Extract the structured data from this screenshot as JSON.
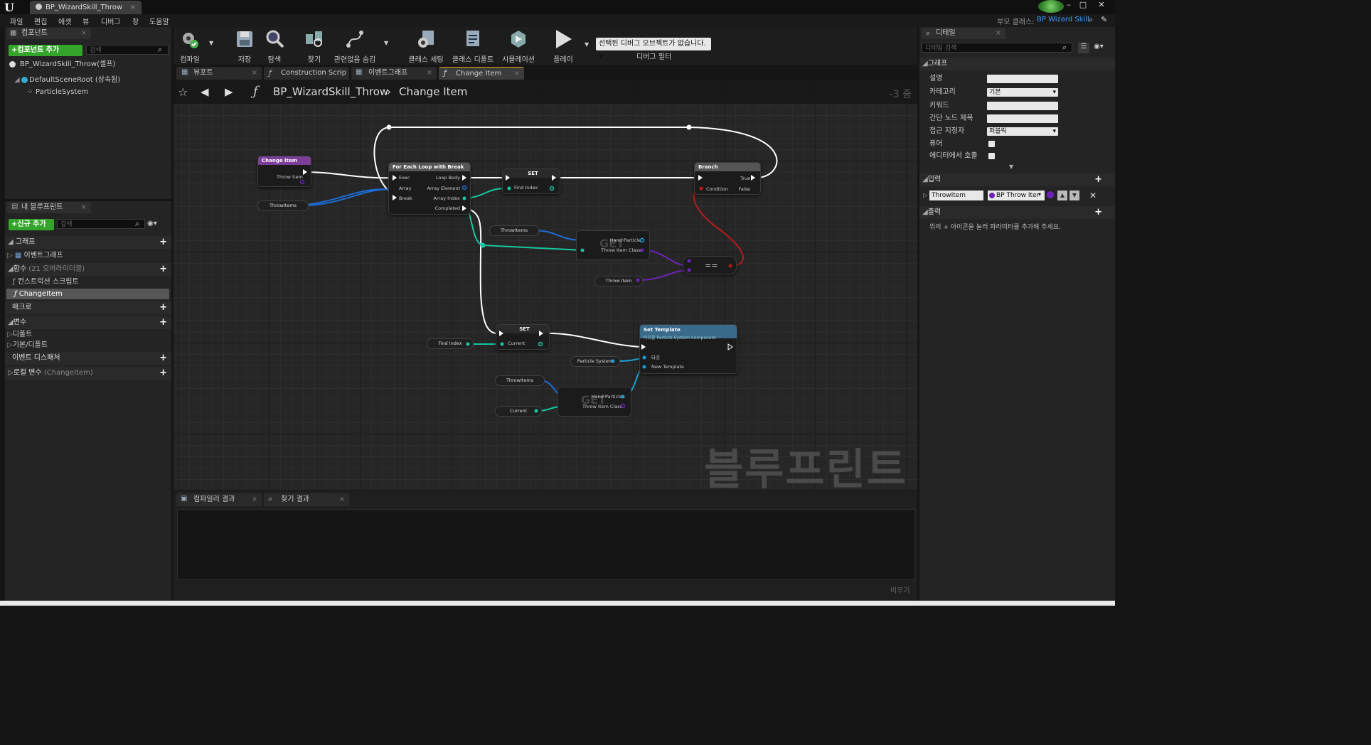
{
  "window": {
    "tab_title": "BP_WizardSkill_Throw"
  },
  "menu": [
    "파일",
    "편집",
    "에셋",
    "뷰",
    "디버그",
    "창",
    "도움말"
  ],
  "parent_class": {
    "label": "부모 클래스:",
    "value": "BP Wizard Skill"
  },
  "components_panel": {
    "tab": "컴포넌트",
    "add_button": "+컴포넌트 추가",
    "search_placeholder": "검색",
    "root": "BP_WizardSkill_Throw(셀프)",
    "items": [
      "DefaultSceneRoot (상속됨)",
      "ParticleSystem"
    ]
  },
  "my_blueprint_panel": {
    "tab": "내 블루프린트",
    "add_button": "+신규 추가",
    "search_placeholder": "검색",
    "graph": "그래프",
    "event_graph": "이벤트그래프",
    "functions": "함수",
    "functions_overridable": "(21 오버라이더블)",
    "construction_script": "컨스트럭션 스크립트",
    "change_item": "ChangeItem",
    "macros": "매크로",
    "variables": "변수",
    "default": "디폴트",
    "basic_default": "기본/디폴트",
    "event_dispatchers": "이벤트 디스패처",
    "local_vars": "로컬 변수",
    "local_vars_scope": "(ChangeItem)"
  },
  "toolbar": [
    {
      "label": "컴파일",
      "icon": "compile-icon"
    },
    {
      "label": "저장",
      "icon": "save-icon"
    },
    {
      "label": "탐색",
      "icon": "browse-icon"
    },
    {
      "label": "찾기",
      "icon": "find-icon"
    },
    {
      "label": "관련없음 숨김",
      "icon": "hide-unrelated-icon"
    },
    {
      "label": "클래스 세팅",
      "icon": "class-settings-icon"
    },
    {
      "label": "클래스 디폴트",
      "icon": "class-defaults-icon"
    },
    {
      "label": "시뮬레이션",
      "icon": "simulation-icon"
    },
    {
      "label": "플레이",
      "icon": "play-icon"
    }
  ],
  "debug": {
    "selected": "선택된 디버그 오브젝트가 없습니다.",
    "label": "디버그 필터"
  },
  "graph_tabs": [
    "뷰포트",
    "Construction Scrip",
    "이벤트그래프",
    "Change Item"
  ],
  "breadcrumb": {
    "blueprint": "BP_WizardSkill_Throw",
    "function": "Change Item",
    "zoom": "-3 줌"
  },
  "nodes": {
    "change_item": {
      "title": "Change Item",
      "pin": "Throw Item"
    },
    "throwitems1": "ThrowItems",
    "foreach": {
      "title": "For Each Loop with Break",
      "exec": "Exec",
      "array": "Array",
      "break": "Break",
      "loop_body": "Loop Body",
      "array_element": "Array Element",
      "array_index": "Array Index",
      "completed": "Completed"
    },
    "set1": {
      "title": "SET",
      "pin": "Find Index"
    },
    "branch": {
      "title": "Branch",
      "condition": "Condition",
      "true": "True",
      "false": "False"
    },
    "throwitems2": "ThrowItems",
    "get1": {
      "pin1": "Hand Particle",
      "pin2": "Throw Item Class",
      "bg": "GET"
    },
    "equals": "==",
    "throw_item": "Throw Item",
    "set2": {
      "title": "SET",
      "pin": "Current"
    },
    "find_index": "Find Index",
    "set_template": {
      "title": "Set Template",
      "subtitle": "타깃을 Particle System Component",
      "target": "타깃",
      "new_template": "New Template"
    },
    "particle_system": "Particle System",
    "throwitems3": "ThrowItems",
    "current": "Current",
    "get2": {
      "pin1": "Hand Particle",
      "pin2": "Throw Item Class",
      "bg": "GET"
    }
  },
  "watermark": "블루프린트",
  "bottom_tabs": [
    "컴파일러 결과",
    "찾기 결과"
  ],
  "clear_button": "비우기",
  "details_panel": {
    "tab": "디테일",
    "search_placeholder": "디테일 검색",
    "graph_section": "그래프",
    "description": "설명",
    "category": "카테고리",
    "category_value": "기본",
    "keywords": "키워드",
    "compact_title": "간단 노드 제목",
    "access": "접근 지정자",
    "access_value": "퍼블릭",
    "pure": "퓨어",
    "call_in_editor": "에디터에서 호출",
    "inputs": "입력",
    "input_name": "ThrowItem",
    "input_type": "BP Throw Iter",
    "outputs": "출력",
    "outputs_hint": "위의 + 아이콘을 눌러 파라미터를 추가해 주세요."
  },
  "colors": {
    "accent_green": "#34a52b",
    "link_blue": "#3b9bff",
    "function_purple": "#7b3f9a",
    "exec_white": "#ffffff",
    "pin_teal": "#17c7a0",
    "pin_purple": "#6d23b8",
    "pin_red": "#b41c1c"
  }
}
